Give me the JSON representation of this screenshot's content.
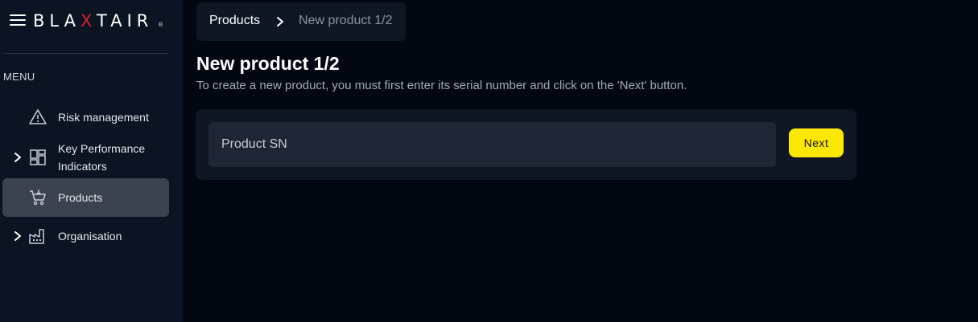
{
  "app": {
    "logo_text": "BLAXTAIR",
    "logo_registered": "®"
  },
  "sidebar": {
    "menu_label": "MENU",
    "items": [
      {
        "label": "Risk management",
        "icon": "warning-triangle-icon",
        "expandable": false,
        "active": false
      },
      {
        "label": "Key Performance Indicators",
        "icon": "dashboard-grid-icon",
        "expandable": true,
        "active": false
      },
      {
        "label": "Products",
        "icon": "cart-icon",
        "expandable": false,
        "active": true
      },
      {
        "label": "Organisation",
        "icon": "factory-icon",
        "expandable": true,
        "active": false
      }
    ]
  },
  "breadcrumb": {
    "root": "Products",
    "current": "New product 1/2"
  },
  "page": {
    "title": "New product 1/2",
    "subtitle": "To create a new product, you must first enter its serial number and click on the 'Next' button."
  },
  "form": {
    "sn_placeholder": "Product SN",
    "sn_value": "",
    "next_label": "Next"
  },
  "colors": {
    "background": "#030712",
    "sidebar": "#0b1422",
    "card": "#0f1724",
    "accent": "#fde803",
    "logo_x": "#e11d2a",
    "active_item": "#3b4351"
  }
}
